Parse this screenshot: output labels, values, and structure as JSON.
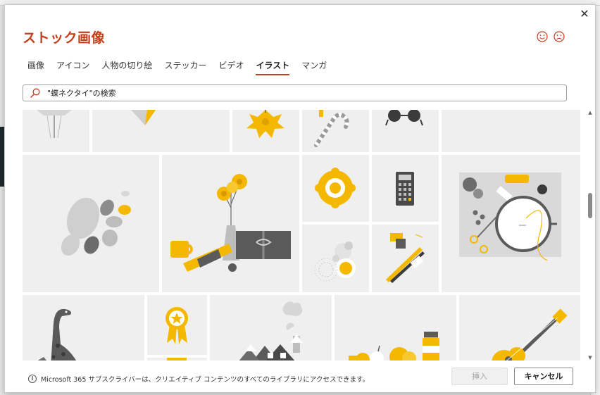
{
  "dialog": {
    "title": "ストック画像",
    "close_glyph": "✕"
  },
  "feedback": {
    "smile_icon": "smile-face-icon",
    "frown_icon": "frown-face-icon"
  },
  "tabs": [
    {
      "label": "画像",
      "active": false
    },
    {
      "label": "アイコン",
      "active": false
    },
    {
      "label": "人物の切り絵",
      "active": false
    },
    {
      "label": "ステッカー",
      "active": false
    },
    {
      "label": "ビデオ",
      "active": false
    },
    {
      "label": "イラスト",
      "active": true
    },
    {
      "label": "マンガ",
      "active": false
    }
  ],
  "search": {
    "value": "\"蝶ネクタイ\"の検索",
    "icon": "search-icon"
  },
  "gallery": {
    "tiles": [
      {
        "name": "umbrella-illustration"
      },
      {
        "name": "partial-illustration"
      },
      {
        "name": "yellow-flower-illustration"
      },
      {
        "name": "candy-cane-illustration"
      },
      {
        "name": "sunglasses-illustration"
      },
      {
        "name": "blank-illustration"
      },
      {
        "name": "pebbles-illustration"
      },
      {
        "name": "flower-vase-gift-illustration"
      },
      {
        "name": "yellow-flower-badge-illustration"
      },
      {
        "name": "calculator-illustration"
      },
      {
        "name": "sewing-embroidery-illustration"
      },
      {
        "name": "dots-circles-illustration"
      },
      {
        "name": "pencils-stationery-illustration"
      },
      {
        "name": "dinosaur-illustration"
      },
      {
        "name": "award-ribbon-illustration"
      },
      {
        "name": "award-ribbon-2-illustration"
      },
      {
        "name": "snowy-village-illustration"
      },
      {
        "name": "fruits-bottle-illustration"
      },
      {
        "name": "guitar-illustration"
      }
    ]
  },
  "colors": {
    "accent": "#c43e1c",
    "illustration_yellow": "#f5b800",
    "illustration_gray": "#8c8c8c",
    "tile_background": "#efefef"
  },
  "footer": {
    "note": "Microsoft 365 サブスクライバーは、クリエイティブ コンテンツのすべてのライブラリにアクセスできます。",
    "info_glyph": "i",
    "insert_label": "挿入",
    "cancel_label": "キャンセル"
  }
}
